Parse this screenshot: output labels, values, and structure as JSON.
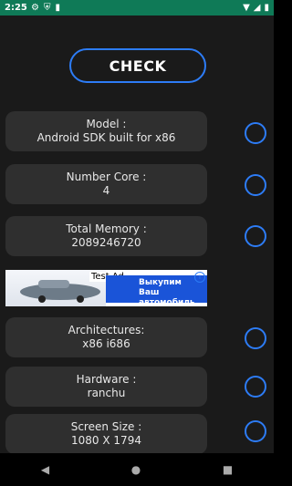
{
  "status_bar": {
    "time": "2:25",
    "icons_left": [
      "settings-icon",
      "shield-icon",
      "sim-icon"
    ],
    "icons_right": [
      "wifi-icon",
      "signal-icon",
      "battery-icon"
    ]
  },
  "check_button": "CHECK",
  "cards": [
    {
      "title": "Model :",
      "value": "Android SDK built for x86"
    },
    {
      "title": "Number Core :",
      "value": "4"
    },
    {
      "title": "Total Memory :",
      "value": "2089246720"
    },
    {
      "title": "Architectures:",
      "value": "x86  i686"
    },
    {
      "title": "Hardware :",
      "value": "ranchu"
    },
    {
      "title": "Screen Size :",
      "value": "1080 X 1794"
    }
  ],
  "ad": {
    "label": "Test Ad",
    "text_line1": "Выкупим",
    "text_line2": "Ваш автомобиль"
  },
  "nav": {
    "back": "◀",
    "home": "●",
    "recents": "■"
  },
  "colors": {
    "status_bar": "#0f7a57",
    "accent": "#2d7cf6",
    "card": "#2f2f2f",
    "background": "#1a1a1a"
  }
}
